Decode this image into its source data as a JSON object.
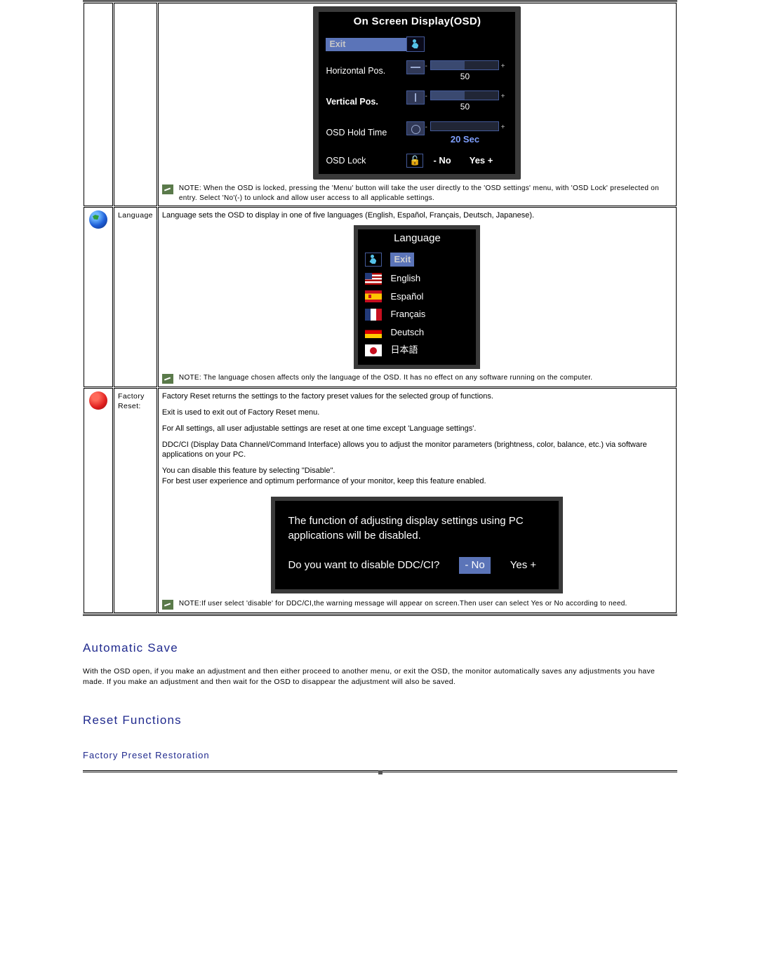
{
  "osd": {
    "title": "On Screen Display(OSD)",
    "exit": "Exit",
    "hpos": "Horizontal Pos.",
    "vpos": "Vertical Pos.",
    "hold": "OSD Hold Time",
    "lock": "OSD Lock",
    "h_val": "50",
    "v_val": "50",
    "hold_val": "20 Sec",
    "lock_no": "- No",
    "lock_yes": "Yes +",
    "note": "NOTE: When the OSD is locked, pressing the 'Menu' button will take the user directly to the 'OSD settings' menu, with 'OSD Lock' preselected on entry. Select 'No'(-) to unlock and allow user access to all applicable settings."
  },
  "language": {
    "row_label": "Language",
    "intro": "Language sets the OSD to display in one of five languages (English, Español, Français, Deutsch, Japanese).",
    "title": "Language",
    "exit": "Exit",
    "items": [
      "English",
      "Español",
      "Français",
      "Deutsch",
      "日本語"
    ],
    "note": "NOTE: The language chosen affects only the language of the OSD. It has no effect on any software running on the computer."
  },
  "factory": {
    "row_label": "Factory Reset:",
    "p1": "Factory Reset returns the settings to the factory preset values for the selected group of functions.",
    "p2": "Exit is used to exit out of Factory Reset menu.",
    "p3": "For All settings, all user adjustable settings are reset at one time except 'Language settings'.",
    "p4": "DDC/CI (Display Data Channel/Command Interface) allows you to adjust the monitor parameters (brightness, color, balance, etc.)  via software applications on your PC.",
    "p5": "You can disable this feature by selecting \"Disable\".",
    "p6": "For best user experience and optimum performance of your monitor, keep this feature enabled.",
    "ddc_text": "The function of adjusting display settings using PC applications will be disabled.",
    "ddc_q": "Do you want to disable DDC/CI?",
    "ddc_no": "- No",
    "ddc_yes": "Yes +",
    "note": "NOTE:If user select 'disable' for DDC/CI,the warning message will appear on screen.Then user can select Yes or No according to need."
  },
  "sections": {
    "auto_h": "Automatic Save",
    "auto_p": "With the OSD open, if you make an adjustment and then either proceed to another menu, or exit the OSD, the monitor automatically saves any adjustments you have made. If you make an adjustment and then wait for the OSD to disappear the adjustment will also be saved.",
    "reset_h": "Reset Functions",
    "reset_sub": "Factory Preset Restoration"
  }
}
